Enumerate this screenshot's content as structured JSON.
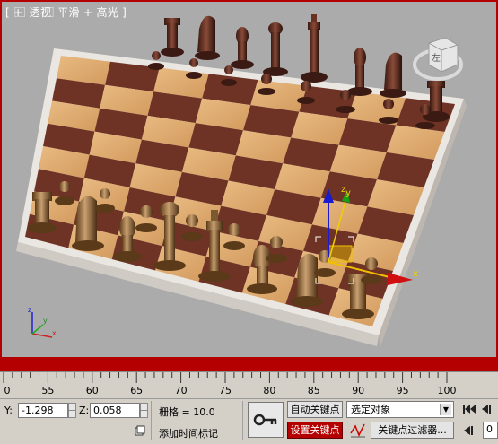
{
  "viewport": {
    "label": "[ + ⃞ 透视 ⃞ 平滑 + 高光 ]",
    "axis_gizmo": {
      "x": "x",
      "y": "y",
      "z": "z"
    },
    "nav_cube_label": "左"
  },
  "timeline": {
    "ticks": [
      "0",
      "55",
      "60",
      "65",
      "70",
      "75",
      "80",
      "85",
      "90",
      "95",
      "100"
    ]
  },
  "status_bar": {
    "y_label": "Y:",
    "y_value": "-1.298",
    "z_label": "Z:",
    "z_value": "0.058",
    "grid_text": "栅格 = 10.0",
    "add_time_tag": "添加时间标记",
    "auto_key": "自动关键点",
    "set_key": "设置关键点",
    "selection_dropdown": "选定对象",
    "key_filters": "关键点过滤器...",
    "frame_value": "0"
  },
  "colors": {
    "active_border": "#b40000",
    "viewport_bg": "#ababab",
    "ui_bg": "#d4d0c8"
  }
}
